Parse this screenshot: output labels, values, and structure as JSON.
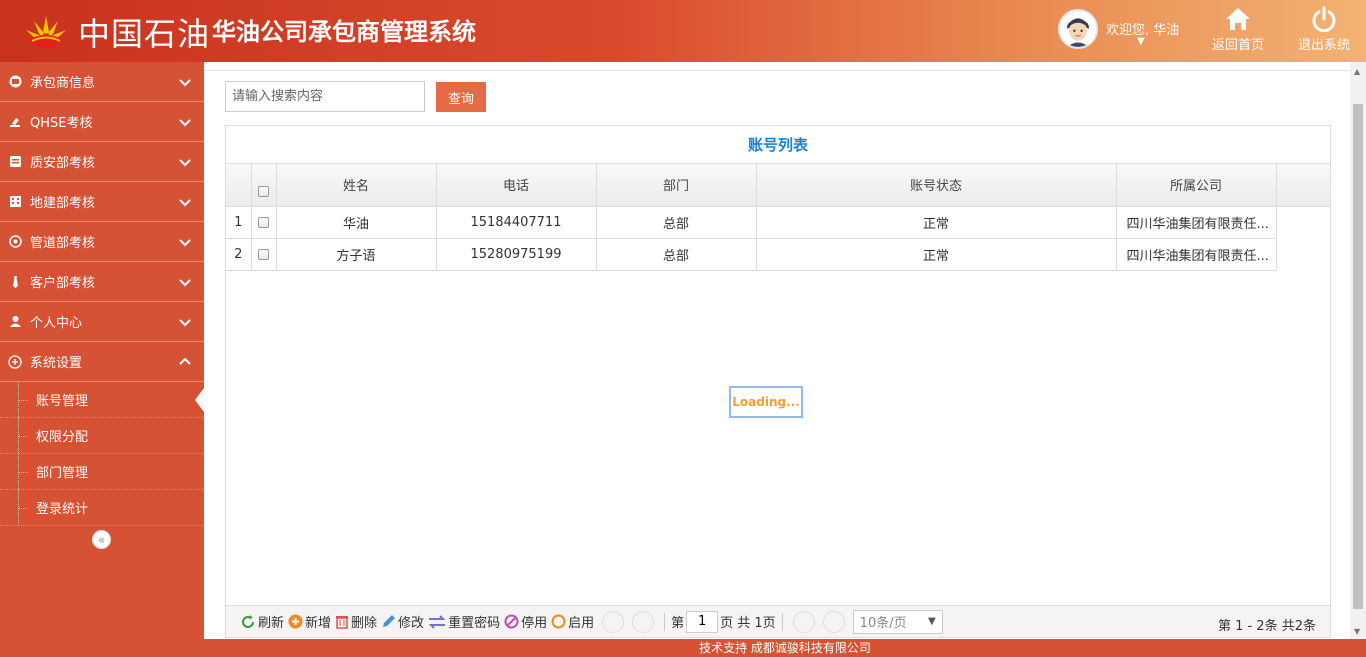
{
  "header": {
    "brand": "中国石油",
    "title": "华油公司承包商管理系统",
    "welcome": "欢迎您, 华油",
    "home_label": "返回首页",
    "exit_label": "退出系统"
  },
  "sidebar": {
    "items": [
      {
        "label": "承包商信息",
        "icon": "card-icon"
      },
      {
        "label": "QHSE考核",
        "icon": "stamp-icon"
      },
      {
        "label": "质安部考核",
        "icon": "document-icon"
      },
      {
        "label": "地建部考核",
        "icon": "building-icon"
      },
      {
        "label": "管道部考核",
        "icon": "pipe-icon"
      },
      {
        "label": "客户部考核",
        "icon": "tie-icon"
      },
      {
        "label": "个人中心",
        "icon": "user-icon"
      },
      {
        "label": "系统设置",
        "icon": "plus-circle-icon"
      }
    ],
    "sub_items": [
      "账号管理",
      "权限分配",
      "部门管理",
      "登录统计"
    ],
    "active_sub": "账号管理"
  },
  "search": {
    "placeholder": "请输入搜索内容",
    "button": "查询"
  },
  "grid": {
    "title": "账号列表",
    "columns": [
      "姓名",
      "电话",
      "部门",
      "账号状态",
      "所属公司"
    ],
    "rows": [
      {
        "num": "1",
        "name": "华油",
        "phone": "15184407711",
        "dept": "总部",
        "status": "正常",
        "company": "四川华油集团有限责任..."
      },
      {
        "num": "2",
        "name": "方子语",
        "phone": "15280975199",
        "dept": "总部",
        "status": "正常",
        "company": "四川华油集团有限责任..."
      }
    ],
    "loading": "Loading..."
  },
  "pager": {
    "refresh": "刷新",
    "add": "新增",
    "delete": "删除",
    "edit": "修改",
    "reset_pwd": "重置密码",
    "disable": "停用",
    "enable": "启用",
    "page_prefix": "第",
    "page_value": "1",
    "page_suffix": "页 共 1页",
    "page_size": "10条/页",
    "info": "第 1 - 2条 共2条"
  },
  "footer": {
    "text": "技术支持 成都诚骏科技有限公司"
  },
  "colors": {
    "primary": "#d65234",
    "accent": "#1b82d2",
    "button": "#e56b45"
  }
}
